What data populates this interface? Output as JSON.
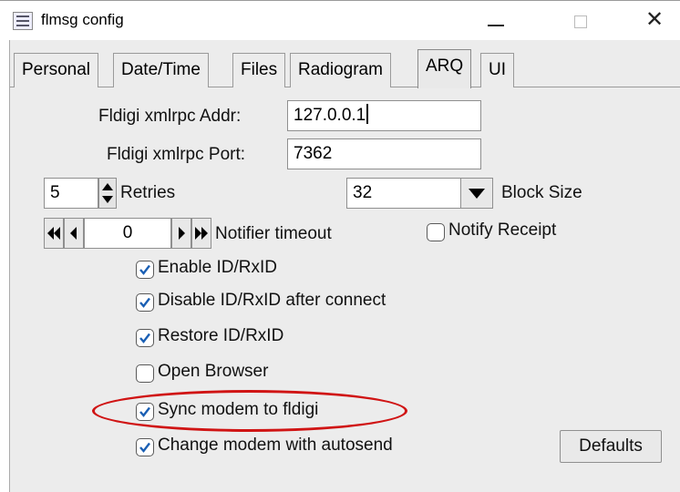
{
  "window": {
    "title": "flmsg config",
    "close_glyph": "✕",
    "icons": [
      "app-icon",
      "minimize-icon",
      "maximize-icon",
      "close-icon"
    ]
  },
  "tabs": [
    {
      "label": "Personal",
      "active": false
    },
    {
      "label": "Date/Time",
      "active": false
    },
    {
      "label": "Files",
      "active": false
    },
    {
      "label": "Radiogram",
      "active": false
    },
    {
      "label": "ARQ",
      "active": true
    },
    {
      "label": "UI",
      "active": false
    }
  ],
  "arq": {
    "xmlrpc_addr": {
      "label": "Fldigi xmlrpc Addr:",
      "value": "127.0.0.1"
    },
    "xmlrpc_port": {
      "label": "Fldigi xmlrpc Port:",
      "value": "7362"
    },
    "retries": {
      "label": "Retries",
      "value": "5"
    },
    "block_size": {
      "label": "Block Size",
      "value": "32"
    },
    "notifier": {
      "label": "Notifier timeout",
      "value": "0"
    },
    "notify_receipt": {
      "label": "Notify Receipt",
      "checked": false
    },
    "checkboxes": [
      {
        "label": "Enable ID/RxID",
        "checked": true
      },
      {
        "label": "Disable ID/RxID after connect",
        "checked": true
      },
      {
        "label": "Restore ID/RxID",
        "checked": true
      },
      {
        "label": "Open Browser",
        "checked": false
      },
      {
        "label": "Sync modem to fldigi",
        "checked": true
      },
      {
        "label": "Change modem with autosend",
        "checked": true
      }
    ],
    "defaults_button": "Defaults"
  },
  "colors": {
    "annotation": "#d01414",
    "check": "#1a5fb4",
    "panel": "#ececec"
  }
}
